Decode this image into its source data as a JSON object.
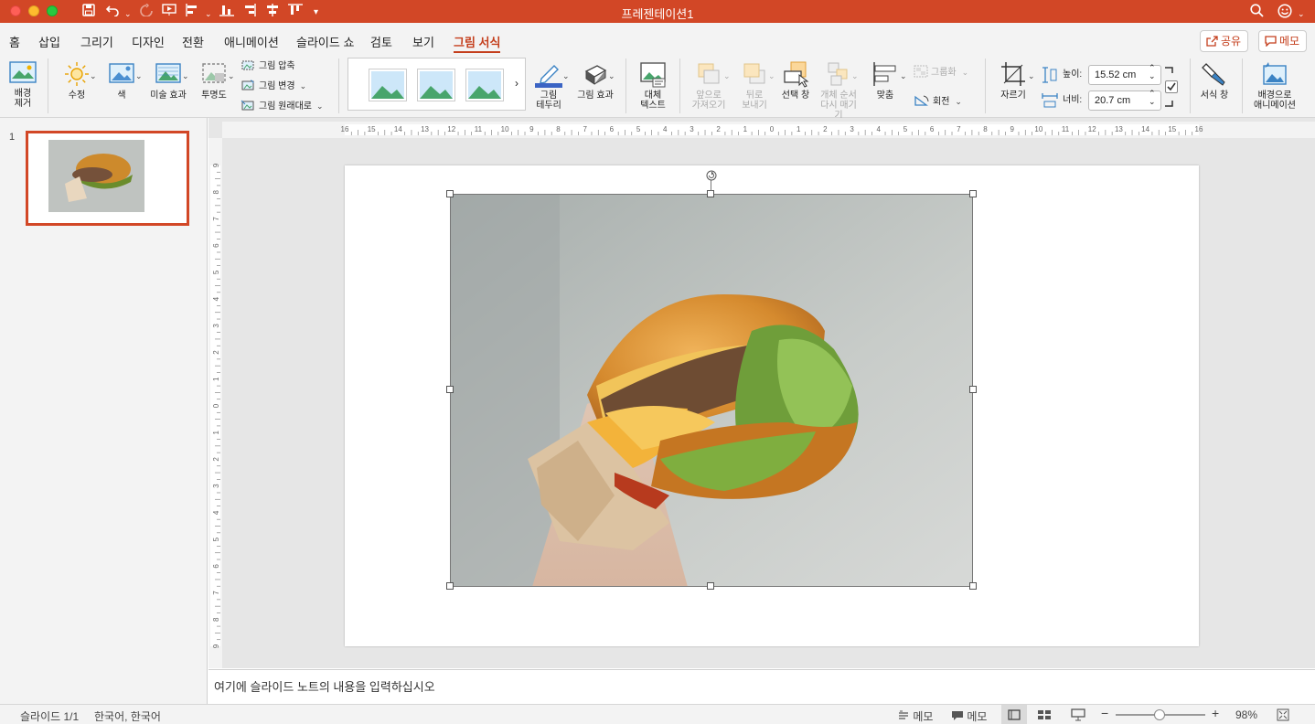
{
  "window": {
    "title": "프레젠테이션1"
  },
  "tabs": [
    "홈",
    "삽입",
    "그리기",
    "디자인",
    "전환",
    "애니메이션",
    "슬라이드 쇼",
    "검토",
    "보기",
    "그림 서식"
  ],
  "active_tab": "그림 서식",
  "header_buttons": {
    "share": "공유",
    "memo": "메모"
  },
  "ribbon": {
    "remove_bg": "배경\n제거",
    "corrections": "수정",
    "color": "색",
    "artistic": "미술 효과",
    "transparency": "투명도",
    "compress": "그림 압축",
    "change_picture": "그림 변경",
    "reset_picture": "그림 원래대로",
    "picture_border": "그림\n테두리",
    "picture_effects": "그림 효과",
    "alt_text": "대체\n텍스트",
    "bring_forward": "앞으로\n가져오기",
    "send_backward": "뒤로\n보내기",
    "selection_pane": "선택 창",
    "reorder": "개체 순서\n다시 매기기",
    "align": "맞춤",
    "group": "그룹화",
    "rotate": "회전",
    "crop": "자르기",
    "height_label": "높이:",
    "height_value": "15.52 cm",
    "width_label": "너비:",
    "width_value": "20.7 cm",
    "format_pane": "서식 창",
    "animate_bg": "배경으로\n애니메이션"
  },
  "slides": [
    {
      "number": "1"
    }
  ],
  "notes_placeholder": "여기에 슬라이드 노트의 내용을 입력하십시오",
  "status": {
    "slide": "슬라이드 1/1",
    "language": "한국어, 한국어",
    "notes": "메모",
    "comments": "메모",
    "zoom": "98%"
  },
  "ruler_h": [
    "16",
    "15",
    "14",
    "13",
    "12",
    "11",
    "10",
    "9",
    "8",
    "7",
    "6",
    "5",
    "4",
    "3",
    "2",
    "1",
    "0",
    "1",
    "2",
    "3",
    "4",
    "5",
    "6",
    "7",
    "8",
    "9",
    "10",
    "11",
    "12",
    "13",
    "14",
    "15",
    "16"
  ],
  "ruler_v": [
    "9",
    "8",
    "7",
    "6",
    "5",
    "4",
    "3",
    "2",
    "1",
    "0",
    "1",
    "2",
    "3",
    "4",
    "5",
    "6",
    "7",
    "8",
    "9"
  ],
  "colors": {
    "accent": "#d24726",
    "tab_active": "#c43e1c"
  }
}
